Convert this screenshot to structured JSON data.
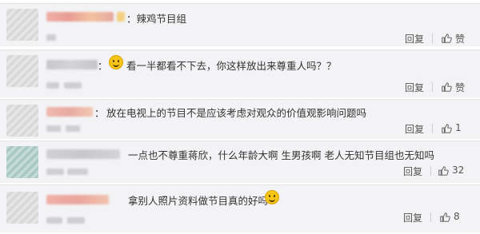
{
  "comments": [
    {
      "text": "：辣鸡节目组",
      "reply_label": "回复",
      "like_label": "赞"
    },
    {
      "text": "看一半都看不下去，你这样放出来尊重人吗？？",
      "prefix": "：",
      "reply_label": "回复",
      "like_label": "赞"
    },
    {
      "text": "放在电视上的节目不是应该考虑对观众的价值观影响问题吗",
      "prefix": "：",
      "reply_label": "回复",
      "like_count": "1"
    },
    {
      "text": "一点也不尊重蒋欣，什么年龄大啊 生男孩啊   老人无知节目组也无知吗",
      "reply_label": "回复",
      "like_count": "32"
    },
    {
      "text": "拿别人照片资料做节目真的好吗",
      "reply_label": "回复",
      "like_count": "8"
    }
  ],
  "colors": {
    "background": "#f3f3f5",
    "text": "#333333",
    "action": "#555555"
  },
  "icons": {
    "like": "thumbs-up-icon",
    "emoji": "smiley-emoji-icon"
  }
}
